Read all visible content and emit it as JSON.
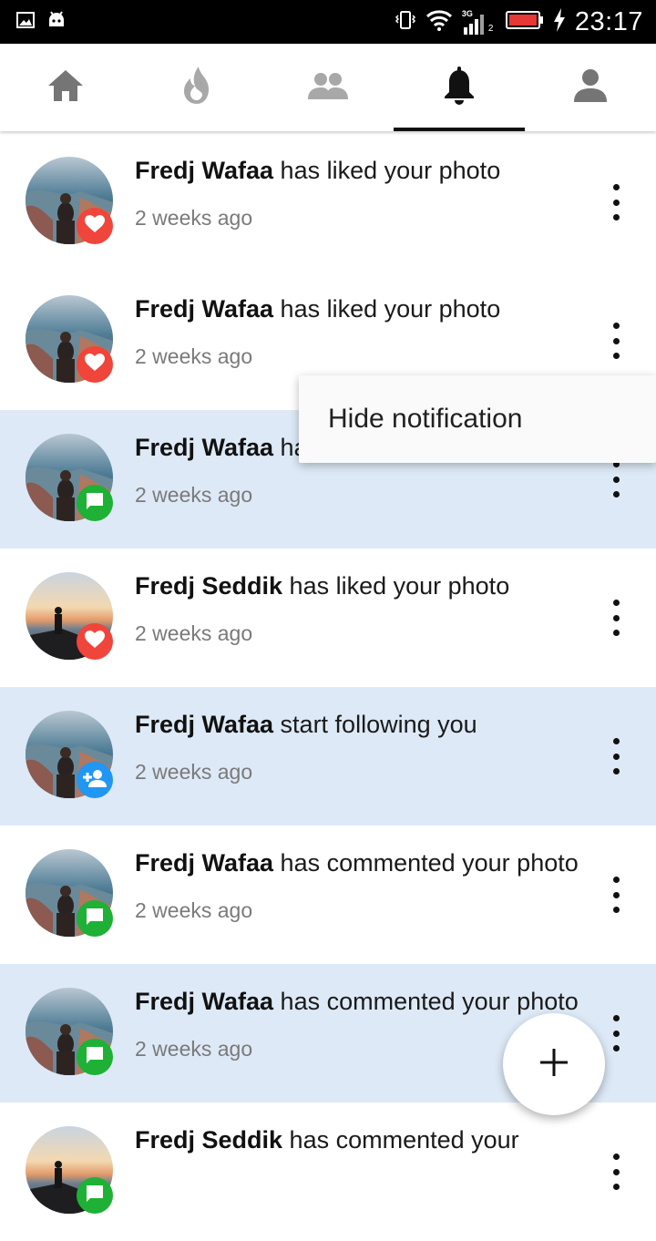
{
  "status_bar": {
    "time": "23:17",
    "network_label": "3G",
    "sim_label": "2",
    "icons": [
      "gallery-icon",
      "android-icon",
      "vibrate-icon",
      "wifi-icon",
      "signal-icon",
      "battery-low-icon",
      "charging-icon"
    ]
  },
  "tabs": [
    {
      "name": "home",
      "icon": "home-icon",
      "active": false
    },
    {
      "name": "trending",
      "icon": "flame-icon",
      "active": false
    },
    {
      "name": "people",
      "icon": "people-icon",
      "active": false
    },
    {
      "name": "notifications",
      "icon": "bell-icon",
      "active": true
    },
    {
      "name": "profile",
      "icon": "person-icon",
      "active": false
    }
  ],
  "notifications": [
    {
      "user": "Fredj Wafaa",
      "action": " has liked your photo",
      "time": "2 weeks ago",
      "type": "like",
      "unread": false,
      "avatar": "wafaa"
    },
    {
      "user": "Fredj Wafaa",
      "action": " has liked your photo",
      "time": "2 weeks ago",
      "type": "like",
      "unread": false,
      "avatar": "wafaa"
    },
    {
      "user": "Fredj Wafaa",
      "action": " ha",
      "time": "2 weeks ago",
      "type": "comment",
      "unread": true,
      "avatar": "wafaa"
    },
    {
      "user": "Fredj Seddik",
      "action": " has liked your photo",
      "time": "2 weeks ago",
      "type": "like",
      "unread": false,
      "avatar": "seddik"
    },
    {
      "user": "Fredj Wafaa",
      "action": " start following you",
      "time": "2 weeks ago",
      "type": "follow",
      "unread": true,
      "avatar": "wafaa"
    },
    {
      "user": "Fredj Wafaa",
      "action": " has commented your photo",
      "time": "2 weeks ago",
      "type": "comment",
      "unread": false,
      "avatar": "wafaa"
    },
    {
      "user": "Fredj Wafaa",
      "action": " has commented your photo",
      "time": "2 weeks ago",
      "type": "comment",
      "unread": true,
      "avatar": "wafaa"
    },
    {
      "user": "Fredj Seddik",
      "action": " has commented your",
      "time": "",
      "type": "comment",
      "unread": false,
      "avatar": "seddik"
    }
  ],
  "popup_menu": {
    "item": "Hide notification"
  },
  "fab": {
    "icon": "plus-icon"
  },
  "colors": {
    "unread_bg": "#dde9f6",
    "like_badge": "#f0453a",
    "comment_badge": "#1eb135",
    "follow_badge": "#2196f3",
    "tab_inactive": "#757575",
    "tab_active": "#111111"
  }
}
